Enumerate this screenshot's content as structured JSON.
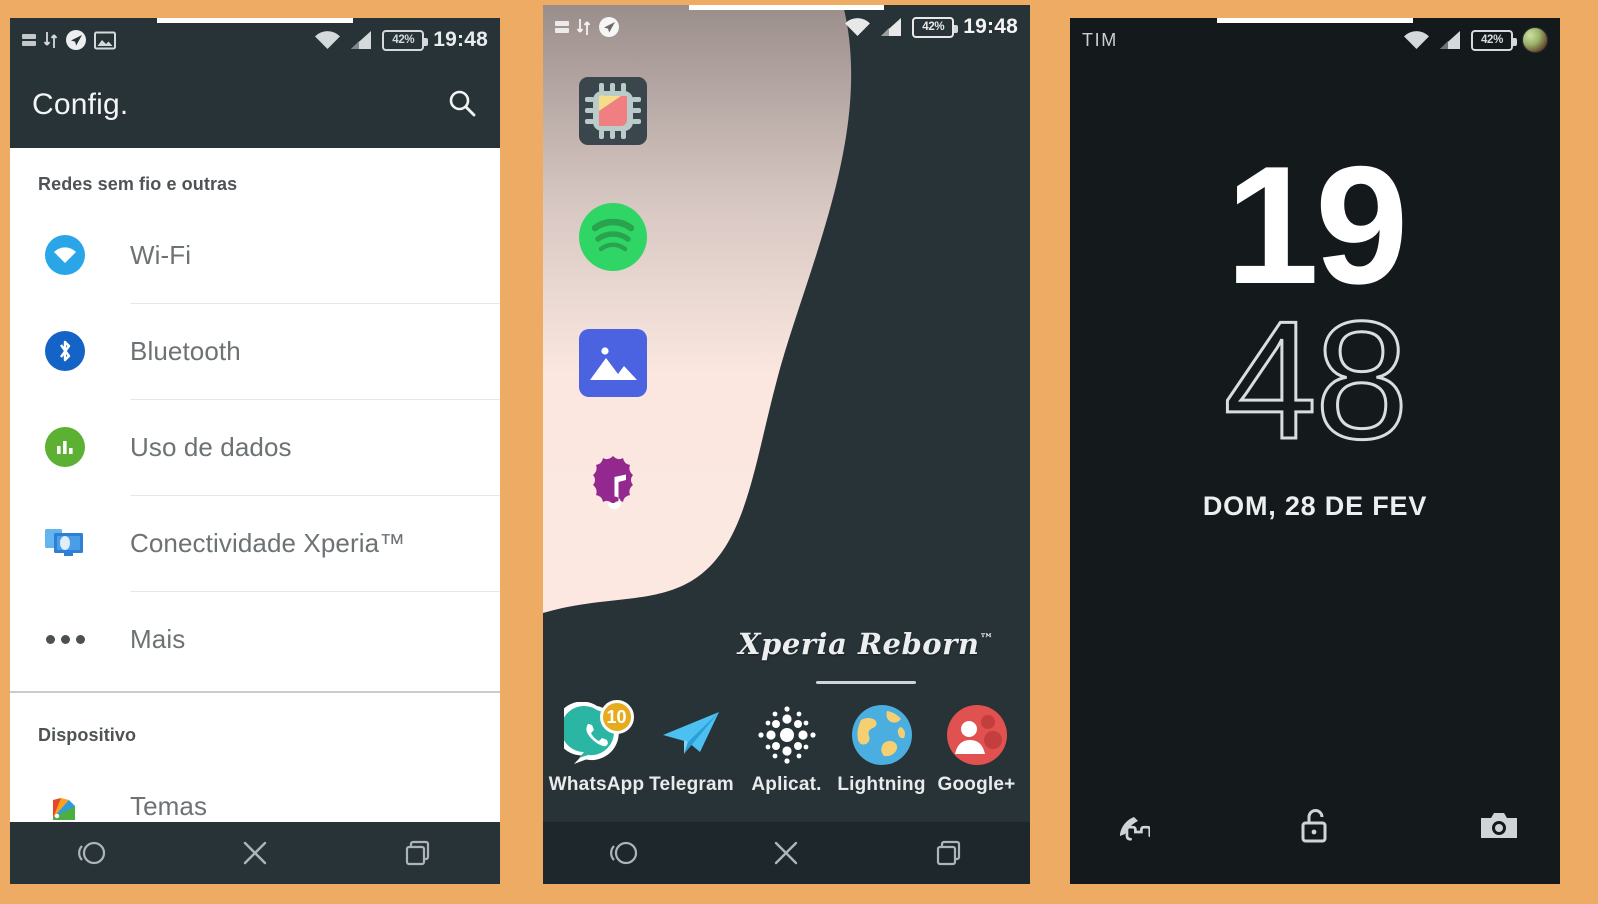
{
  "background_color": "#eeab63",
  "settings_panel": {
    "name": "settings-screen",
    "statusbar": {
      "icons": [
        "data-rate-icon",
        "data-transfer-icon",
        "location-icon",
        "screenshot-icon"
      ],
      "wifi_icon": "wifi-icon",
      "signal_icon": "signal-bars-icon",
      "battery_label": "42%",
      "time": "19:48"
    },
    "appbar": {
      "title": "Config.",
      "search_icon": "search-icon"
    },
    "sections": [
      {
        "header": "Redes sem fio e outras",
        "items": [
          {
            "label": "Wi-Fi",
            "icon": "wifi-icon",
            "color": "#2aa6e8"
          },
          {
            "label": "Bluetooth",
            "icon": "bluetooth-icon",
            "color": "#1464c8"
          },
          {
            "label": "Uso de dados",
            "icon": "data-usage-icon",
            "color": "#5cb032"
          },
          {
            "label": "Conectividade Xperia™",
            "icon": "screen-mirroring-icon",
            "color": "#3d8ae0"
          },
          {
            "label": "Mais",
            "icon": "more-dots-icon",
            "color": "#4b5052"
          }
        ]
      },
      {
        "header": "Dispositivo",
        "items": [
          {
            "label": "Temas",
            "icon": "themes-palette-icon",
            "color": "#e8452b"
          }
        ]
      }
    ],
    "navbar": [
      {
        "name": "back-button",
        "icon": "back-circle-icon"
      },
      {
        "name": "home-button",
        "icon": "close-x-icon"
      },
      {
        "name": "recents-button",
        "icon": "recents-square-icon"
      }
    ]
  },
  "home_panel": {
    "name": "home-screen",
    "statusbar": {
      "icons": [
        "data-rate-icon",
        "data-transfer-icon",
        "location-icon"
      ],
      "wifi_icon": "wifi-icon",
      "signal_icon": "signal-bars-icon",
      "battery_label": "42%",
      "time": "19:48"
    },
    "app_icons": [
      {
        "name": "cpu-chip-icon",
        "label": ""
      },
      {
        "name": "spotify-icon",
        "label": ""
      },
      {
        "name": "gallery-icon",
        "label": ""
      },
      {
        "name": "music-note-icon",
        "label": ""
      }
    ],
    "branding": {
      "text": "Xperia Reborn",
      "trademark": "™"
    },
    "dock": [
      {
        "label": "WhatsApp",
        "icon": "whatsapp-icon",
        "badge": "10"
      },
      {
        "label": "Telegram",
        "icon": "telegram-icon",
        "badge": ""
      },
      {
        "label": "Aplicat.",
        "icon": "app-drawer-icon",
        "badge": ""
      },
      {
        "label": "Lightning",
        "icon": "globe-browser-icon",
        "badge": ""
      },
      {
        "label": "Google+",
        "icon": "google-plus-icon",
        "badge": ""
      }
    ],
    "navbar": [
      {
        "name": "back-button",
        "icon": "back-circle-icon"
      },
      {
        "name": "home-button",
        "icon": "close-x-icon"
      },
      {
        "name": "recents-button",
        "icon": "recents-square-icon"
      }
    ]
  },
  "lock_panel": {
    "name": "lock-screen",
    "statusbar": {
      "carrier": "TIM",
      "wifi_icon": "wifi-icon",
      "signal_icon": "signal-bars-icon",
      "battery_label": "42%",
      "avatar_icon": "user-avatar-icon"
    },
    "clock": {
      "hours": "19",
      "minutes": "48",
      "date": "DOM, 28 DE FEV"
    },
    "actions": [
      {
        "name": "phone-shortcut",
        "icon": "phone-handset-icon"
      },
      {
        "name": "unlock-indicator",
        "icon": "unlocked-padlock-icon"
      },
      {
        "name": "camera-shortcut",
        "icon": "camera-icon"
      }
    ]
  }
}
